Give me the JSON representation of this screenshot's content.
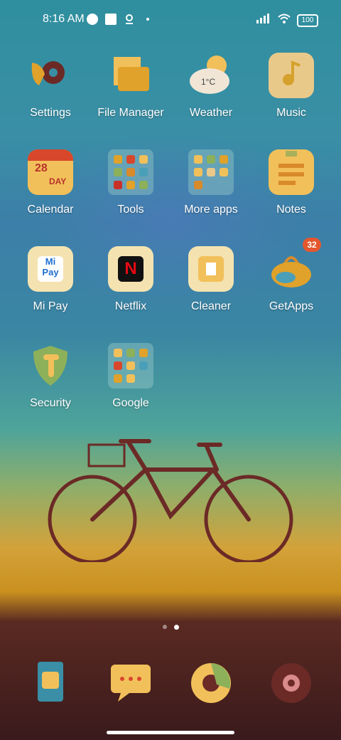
{
  "status_bar": {
    "time": "8:16 AM",
    "battery": "100",
    "icons": [
      "notification-icon",
      "square-icon",
      "location-icon",
      "signal-icon",
      "wifi-icon",
      "battery-icon"
    ]
  },
  "apps": [
    {
      "label": "Settings"
    },
    {
      "label": "File Manager"
    },
    {
      "label": "Weather",
      "icon_text": "1°C"
    },
    {
      "label": "Music"
    },
    {
      "label": "Calendar",
      "icon_text": "28",
      "icon_subtext": "DAY"
    },
    {
      "label": "Tools"
    },
    {
      "label": "More apps"
    },
    {
      "label": "Notes"
    },
    {
      "label": "Mi Pay",
      "icon_text": "Mi",
      "icon_subtext": "Pay"
    },
    {
      "label": "Netflix",
      "icon_text": "N"
    },
    {
      "label": "Cleaner"
    },
    {
      "label": "GetApps",
      "badge": "32"
    },
    {
      "label": "Security"
    },
    {
      "label": "Google"
    }
  ],
  "dock": [
    {
      "name": "phone"
    },
    {
      "name": "messages"
    },
    {
      "name": "browser"
    },
    {
      "name": "camera"
    }
  ],
  "page_indicator": {
    "pages": 2,
    "active": 2
  },
  "colors": {
    "badge": "#e4572e",
    "folder_bg": "#9cc8c8"
  }
}
